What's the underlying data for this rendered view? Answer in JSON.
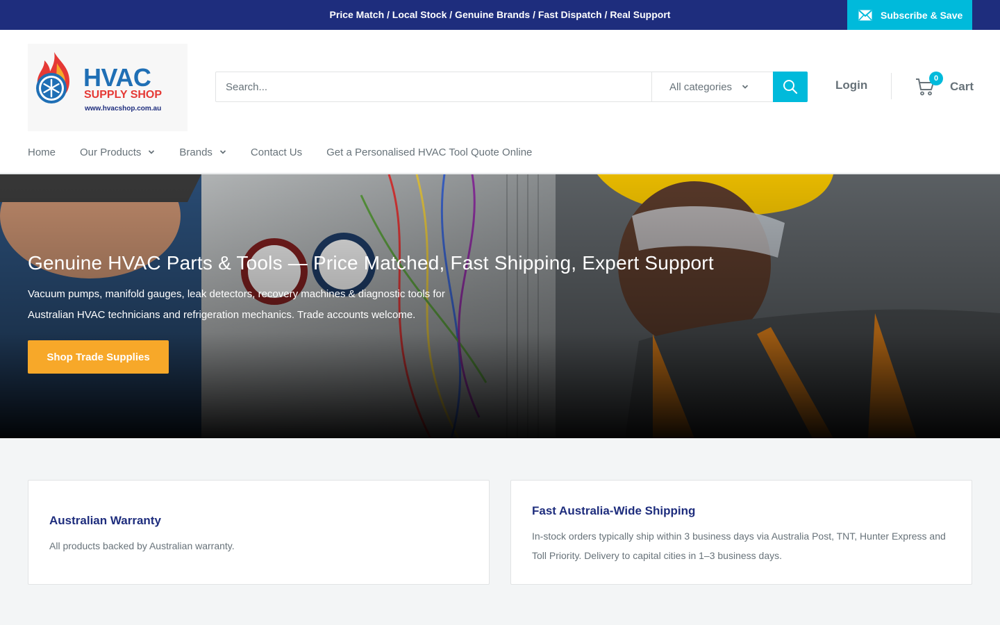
{
  "announcement": {
    "text": "Price Match / Local Stock / Genuine Brands / Fast Dispatch / Real Support",
    "subscribe_label": "Subscribe & Save",
    "subscribe_icon": "mail-icon",
    "background_color": "#1e2d7d",
    "accent_color": "#00badb"
  },
  "logo": {
    "line1": "HVAC",
    "line2": "SUPPLY SHOP",
    "url": "www.hvacshop.com.au"
  },
  "search": {
    "placeholder": "Search...",
    "category_selected": "All categories",
    "button_icon": "search-icon"
  },
  "account": {
    "login_label": "Login",
    "cart_label": "Cart",
    "cart_count": "0",
    "cart_icon": "cart-icon"
  },
  "nav": {
    "items": [
      {
        "label": "Home",
        "has_dropdown": false
      },
      {
        "label": "Our Products",
        "has_dropdown": true
      },
      {
        "label": "Brands",
        "has_dropdown": true
      },
      {
        "label": "Contact Us",
        "has_dropdown": false
      },
      {
        "label": "Get a Personalised HVAC Tool Quote Online",
        "has_dropdown": false
      }
    ]
  },
  "hero": {
    "title": "Genuine HVAC Parts & Tools — Price Matched, Fast Shipping, Expert Support",
    "subtitle": "Vacuum pumps, manifold gauges, leak detectors, recovery machines & diagnostic tools for Australian HVAC technicians and refrigeration mechanics. Trade accounts welcome.",
    "cta_label": "Shop Trade Supplies",
    "cta_color": "#f7a829"
  },
  "info_cards": [
    {
      "title": "Australian Warranty",
      "text": "All products backed by Australian warranty."
    },
    {
      "title": "Fast Australia-Wide Shipping",
      "text": "In-stock orders typically ship within 3 business days via Australia Post, TNT, Hunter Express and Toll Priority. Delivery to capital cities in 1–3 business days."
    }
  ]
}
